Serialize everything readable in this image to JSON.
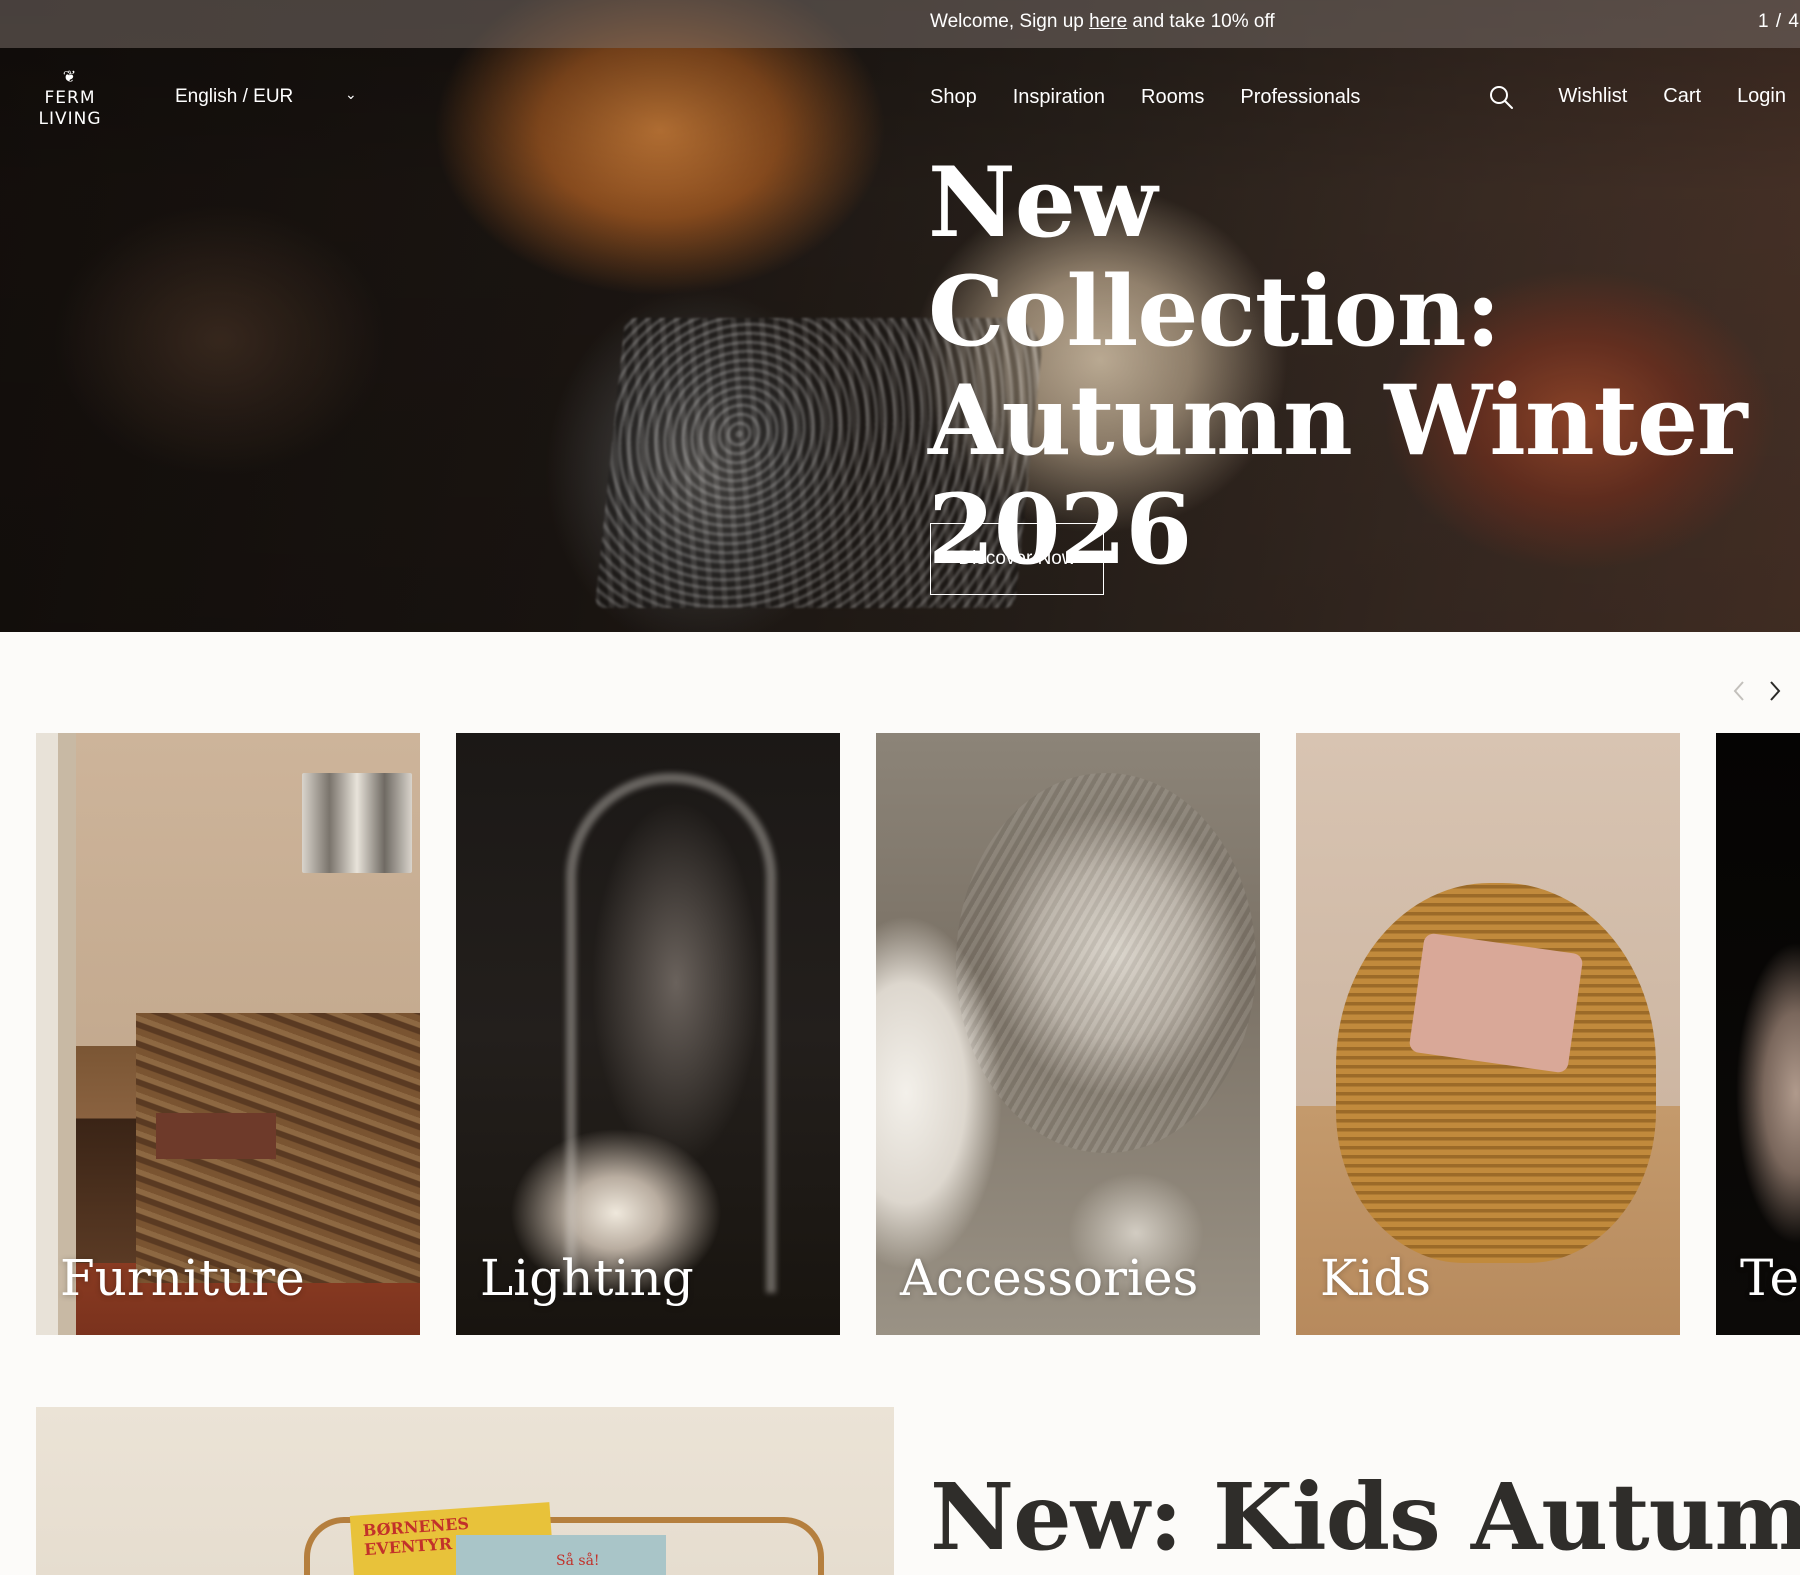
{
  "announcement": {
    "prefix": "Welcome, Sign up ",
    "link": "here",
    "suffix": " and take 10% off",
    "pager": "1 / 4"
  },
  "nav": {
    "logo_line1": "FERM",
    "logo_line2": "LIVING",
    "language": "English / EUR",
    "menu": [
      "Shop",
      "Inspiration",
      "Rooms",
      "Professionals"
    ],
    "utils": [
      "Wishlist",
      "Cart",
      "Login"
    ]
  },
  "hero": {
    "title_line1": "New Collection:",
    "title_line2": "Autumn Winter",
    "title_line3": "2026",
    "cta": "Discover Now"
  },
  "categories": [
    {
      "label": "Furniture"
    },
    {
      "label": "Lighting"
    },
    {
      "label": "Accessories"
    },
    {
      "label": "Kids"
    },
    {
      "label": "Te"
    }
  ],
  "promo": {
    "title": "New: Kids Autumn",
    "book1_text": "BØRNENES EVENTYR",
    "book2_text": "Så så!"
  },
  "colors": {
    "page_bg": "#fcfbf9",
    "text": "#2b2a28",
    "hero_text": "#ffffff"
  }
}
